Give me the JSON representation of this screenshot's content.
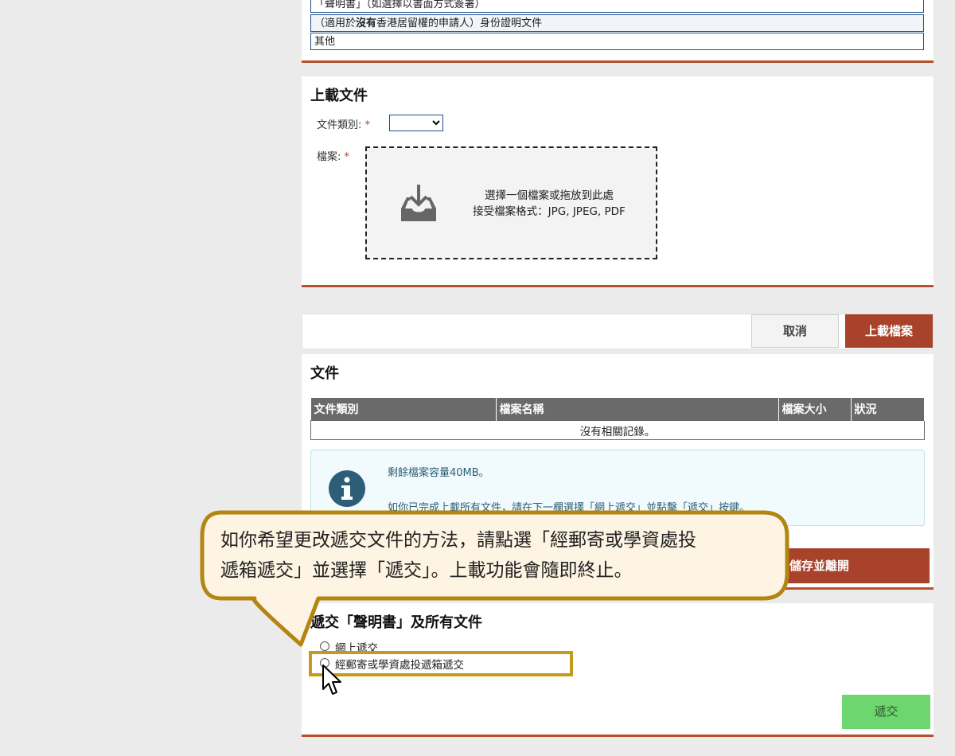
{
  "options": {
    "row1": "「聲明書」（如選擇以書面方式簽署）",
    "row2_prefix": "（適用於",
    "row2_bold": "沒有",
    "row2_suffix": "香港居留權的申請人）身份證明文件",
    "row3": "其他"
  },
  "upload": {
    "title": "上載文件",
    "doc_type_label": "文件類別:",
    "file_label": "檔案:",
    "required_mark": "*",
    "select_value": "",
    "dropzone_line1": "選擇一個檔案或拖放到此處",
    "dropzone_line2": "接受檔案格式：JPG, JPEG, PDF",
    "cancel_label": "取消",
    "upload_label": "上載檔案"
  },
  "documents": {
    "title": "文件",
    "columns": [
      "文件類別",
      "檔案名稱",
      "檔案大小",
      "狀況"
    ],
    "empty_text": "沒有相關記錄。",
    "info_line1": "剩餘檔案容量40MB。",
    "info_line2": "如你已完成上載所有文件，請在下一欄選擇「網上遞交」並點擊「遞交」按鍵。",
    "save_label": "儲存並離開"
  },
  "callout": {
    "line1": "如你希望更改遞交文件的方法，請點選「經郵寄或學資處投",
    "line2": "遞箱遞交」並選擇「遞交」。上載功能會隨即終止。"
  },
  "submit": {
    "title": "遞交「聲明書」及所有文件",
    "option1": "網上遞交",
    "option2": "經郵寄或學資處投遞箱遞交",
    "submit_label": "遞交"
  },
  "colors": {
    "accent_brown": "#a8422a",
    "highlight_gold": "#c69a1b",
    "submit_green": "#6ed66e",
    "info_blue": "#2c5f77"
  }
}
